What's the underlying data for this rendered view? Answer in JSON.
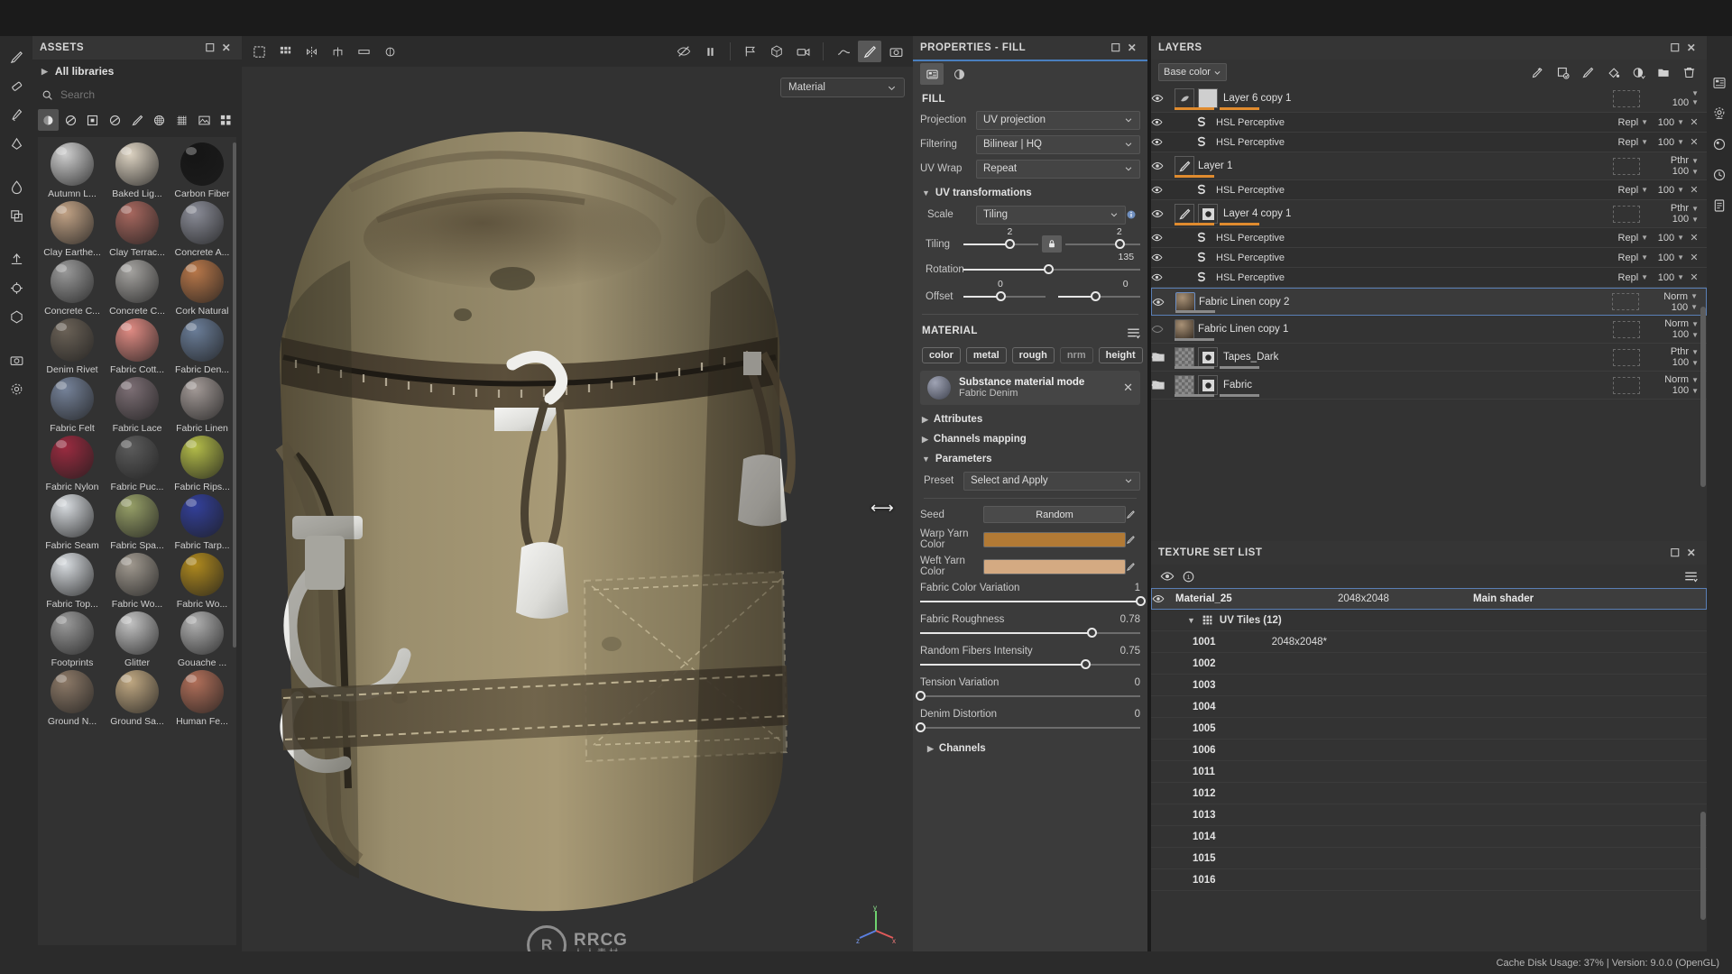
{
  "app": {
    "status_text": "Cache Disk Usage:   37% | Version: 9.0.0 (OpenGL)"
  },
  "left_toolbar": {
    "tools": [
      {
        "name": "paint-tool-icon",
        "glyph": "brush"
      },
      {
        "name": "eraser-tool-icon",
        "glyph": "eraser"
      },
      {
        "name": "projection-tool-icon",
        "glyph": "proj"
      },
      {
        "name": "polygon-fill-tool-icon",
        "glyph": "polyfill"
      },
      {
        "name": "smudge-tool-icon",
        "glyph": "smudge"
      },
      {
        "name": "clone-tool-icon",
        "glyph": "clone"
      },
      {
        "name": "export-icon",
        "glyph": "export"
      },
      {
        "name": "bake-icon",
        "glyph": "bake"
      },
      {
        "name": "tri-planar-icon",
        "glyph": "tri"
      },
      {
        "name": "camera-icon",
        "glyph": "cam"
      },
      {
        "name": "settings-icon",
        "glyph": "gear"
      }
    ]
  },
  "assets": {
    "title": "ASSETS",
    "library_label": "All libraries",
    "search_placeholder": "Search",
    "filters": [
      {
        "name": "filter-materials-icon",
        "active": true
      },
      {
        "name": "filter-smart-materials-icon",
        "active": false
      },
      {
        "name": "filter-smart-masks-icon",
        "active": false
      },
      {
        "name": "filter-alphas-icon",
        "active": false
      },
      {
        "name": "filter-brushes-icon",
        "active": false
      },
      {
        "name": "filter-procedurals-icon",
        "active": false
      },
      {
        "name": "filter-grunges-icon",
        "active": false
      },
      {
        "name": "filter-textures-icon",
        "active": false
      },
      {
        "name": "filter-all-icon",
        "active": false
      }
    ],
    "items": [
      {
        "label": "Autumn L...",
        "color": "#cfcfcf"
      },
      {
        "label": "Baked Lig...",
        "color": "#ddd3c2"
      },
      {
        "label": "Carbon Fiber",
        "color": "#151515"
      },
      {
        "label": "Clay Earthe...",
        "color": "#c2a386"
      },
      {
        "label": "Clay Terrac...",
        "color": "#a8685f"
      },
      {
        "label": "Concrete A...",
        "color": "#8b8d98"
      },
      {
        "label": "Concrete C...",
        "color": "#9a9a9a"
      },
      {
        "label": "Concrete C...",
        "color": "#a5a3a0"
      },
      {
        "label": "Cork Natural",
        "color": "#b9784a"
      },
      {
        "label": "Denim Rivet",
        "color": "#6b6257"
      },
      {
        "label": "Fabric Cott...",
        "color": "#e08b83"
      },
      {
        "label": "Fabric Den...",
        "color": "#6b7e99"
      },
      {
        "label": "Fabric Felt",
        "color": "#76839a"
      },
      {
        "label": "Fabric Lace",
        "color": "#7d6f75"
      },
      {
        "label": "Fabric Linen",
        "color": "#a39a97"
      },
      {
        "label": "Fabric Nylon",
        "color": "#9b2b40"
      },
      {
        "label": "Fabric Puc...",
        "color": "#5c5c5c"
      },
      {
        "label": "Fabric Rips...",
        "color": "#b4bd49"
      },
      {
        "label": "Fabric Seam",
        "color": "#d8dce0"
      },
      {
        "label": "Fabric Spa...",
        "color": "#97a068"
      },
      {
        "label": "Fabric Tarp...",
        "color": "#33409b"
      },
      {
        "label": "Fabric Top...",
        "color": "#d8dce0"
      },
      {
        "label": "Fabric Wo...",
        "color": "#a19a90"
      },
      {
        "label": "Fabric Wo...",
        "color": "#b08a1e"
      },
      {
        "label": "Footprints",
        "color": "#9a9a9a"
      },
      {
        "label": "Glitter",
        "color": "#c3c3c3"
      },
      {
        "label": "Gouache ...",
        "color": "#b0b0b0"
      },
      {
        "label": "Ground N...",
        "color": "#8d7a68"
      },
      {
        "label": "Ground Sa...",
        "color": "#c0a882"
      },
      {
        "label": "Human Fe...",
        "color": "#b2705a"
      }
    ]
  },
  "viewport": {
    "toolbar": [
      {
        "name": "uv-view-toggle-icon",
        "active": false
      },
      {
        "name": "grid-toggle-icon",
        "active": false
      },
      {
        "name": "symmetry-icon",
        "active": false
      },
      {
        "name": "mirror-icon",
        "active": false
      },
      {
        "name": "display-settings-icon",
        "active": false
      },
      {
        "name": "rotate-env-icon",
        "active": false
      },
      {
        "name": "hide-overlay-icon",
        "active": false
      },
      {
        "name": "pause-engine-icon",
        "active": false
      },
      {
        "name": "flag-icon",
        "active": false
      },
      {
        "name": "3d-view-icon",
        "active": false
      },
      {
        "name": "camera-view-icon",
        "active": false
      },
      {
        "name": "physical-size-icon",
        "active": false
      },
      {
        "name": "paint-mode-icon",
        "active": true
      },
      {
        "name": "screenshot-icon",
        "active": false
      }
    ],
    "material_select": "Material"
  },
  "properties": {
    "title": "PROPERTIES - FILL",
    "fill": {
      "heading": "FILL",
      "projection_label": "Projection",
      "projection_value": "UV projection",
      "filtering_label": "Filtering",
      "filtering_value": "Bilinear | HQ",
      "uvwrap_label": "UV Wrap",
      "uvwrap_value": "Repeat"
    },
    "uv_transformations": {
      "heading": "UV transformations",
      "scale_label": "Scale",
      "scale_value": "Tiling",
      "tiling_label": "Tiling",
      "tiling_u": "2",
      "tiling_v": "2",
      "rotation_label": "Rotation",
      "rotation_value": "135",
      "offset_label": "Offset",
      "offset_u": "0",
      "offset_v": "0"
    },
    "material": {
      "heading": "MATERIAL",
      "channels": [
        {
          "label": "color",
          "on": true
        },
        {
          "label": "metal",
          "on": true
        },
        {
          "label": "rough",
          "on": true
        },
        {
          "label": "nrm",
          "on": false
        },
        {
          "label": "height",
          "on": true
        }
      ],
      "card_title": "Substance material mode",
      "card_subtitle": "Fabric Denim"
    },
    "groups": {
      "attributes": "Attributes",
      "channels_mapping": "Channels mapping",
      "parameters": "Parameters",
      "channels": "Channels"
    },
    "parameters": {
      "preset_label": "Preset",
      "preset_value": "Select and Apply",
      "seed_label": "Seed",
      "seed_value": "Random",
      "warp_label": "Warp Yarn Color",
      "warp_color": "#b27a35",
      "weft_label": "Weft Yarn Color",
      "weft_color": "#d4aa82",
      "sliders": [
        {
          "label": "Fabric Color Variation",
          "value": "1",
          "pct": 100
        },
        {
          "label": "Fabric Roughness",
          "value": "0.78",
          "pct": 78
        },
        {
          "label": "Random Fibers Intensity",
          "value": "0.75",
          "pct": 75
        },
        {
          "label": "Tension Variation",
          "value": "0",
          "pct": 0
        },
        {
          "label": "Denim Distortion",
          "value": "0",
          "pct": 0
        }
      ]
    }
  },
  "layers": {
    "title": "LAYERS",
    "channel_select": "Base color",
    "toolbar": [
      {
        "name": "add-effect-icon"
      },
      {
        "name": "add-fill-layer-icon"
      },
      {
        "name": "add-paint-layer-icon"
      },
      {
        "name": "add-fill-icon"
      },
      {
        "name": "add-adjustment-icon"
      },
      {
        "name": "add-folder-icon"
      },
      {
        "name": "delete-layer-icon"
      }
    ],
    "rows": [
      {
        "kind": "layer",
        "visible": true,
        "name": "Layer 6 copy 1",
        "blend": "",
        "opacity": "100",
        "thumb": "smudge",
        "mask": "masked",
        "bars": [
          "#e08b2e",
          "#e08b2e"
        ],
        "partial": true
      },
      {
        "kind": "effect",
        "visible": true,
        "name": "HSL Perceptive",
        "blend": "Repl",
        "opacity": "100"
      },
      {
        "kind": "effect",
        "visible": true,
        "name": "HSL Perceptive",
        "blend": "Repl",
        "opacity": "100"
      },
      {
        "kind": "layer",
        "visible": true,
        "name": "Layer 1",
        "blend": "Pthr",
        "opacity": "100",
        "thumb": "brush",
        "mask": "none",
        "bars": [
          "#e08b2e"
        ]
      },
      {
        "kind": "effect",
        "visible": true,
        "name": "HSL Perceptive",
        "blend": "Repl",
        "opacity": "100"
      },
      {
        "kind": "layer",
        "visible": true,
        "name": "Layer 4 copy 1",
        "blend": "Pthr",
        "opacity": "100",
        "thumb": "brush",
        "mask": "circle",
        "bars": [
          "#e08b2e",
          "#e08b2e"
        ]
      },
      {
        "kind": "effect",
        "visible": true,
        "name": "HSL Perceptive",
        "blend": "Repl",
        "opacity": "100"
      },
      {
        "kind": "effect",
        "visible": true,
        "name": "HSL Perceptive",
        "blend": "Repl",
        "opacity": "100"
      },
      {
        "kind": "effect",
        "visible": true,
        "name": "HSL Perceptive",
        "blend": "Repl",
        "opacity": "100"
      },
      {
        "kind": "layer",
        "visible": true,
        "selected": true,
        "name": "Fabric Linen copy 2",
        "blend": "Norm",
        "opacity": "100",
        "thumb": "ball",
        "mask": "none",
        "bars": [
          "#8a8a8a"
        ]
      },
      {
        "kind": "layer",
        "visible": false,
        "name": "Fabric Linen copy 1",
        "blend": "Norm",
        "opacity": "100",
        "thumb": "ball",
        "mask": "none",
        "bars": [
          "#8a8a8a"
        ]
      },
      {
        "kind": "folder",
        "visible": true,
        "name": "Tapes_Dark",
        "blend": "Pthr",
        "opacity": "100",
        "bars": [
          "#8a8a8a",
          "#8a8a8a"
        ]
      },
      {
        "kind": "folder",
        "visible": true,
        "name": "Fabric",
        "blend": "Norm",
        "opacity": "100",
        "bars": [
          "#8a8a8a",
          "#8a8a8a"
        ]
      }
    ]
  },
  "texture_set_list": {
    "title": "TEXTURE SET LIST",
    "material": {
      "name": "Material_25",
      "resolution": "2048x2048",
      "shader": "Main shader"
    },
    "uv_tiles_label": "UV Tiles (12)",
    "tiles": [
      {
        "id": "1001",
        "res": "2048x2048*"
      },
      {
        "id": "1002",
        "res": ""
      },
      {
        "id": "1003",
        "res": ""
      },
      {
        "id": "1004",
        "res": ""
      },
      {
        "id": "1005",
        "res": ""
      },
      {
        "id": "1006",
        "res": ""
      },
      {
        "id": "1011",
        "res": ""
      },
      {
        "id": "1012",
        "res": ""
      },
      {
        "id": "1013",
        "res": ""
      },
      {
        "id": "1014",
        "res": ""
      },
      {
        "id": "1015",
        "res": ""
      },
      {
        "id": "1016",
        "res": ""
      }
    ]
  },
  "watermark": {
    "line1": "RRCG",
    "line2": "人人素材",
    "ring": "R"
  },
  "right_rail": [
    {
      "name": "properties-rail-icon"
    },
    {
      "name": "display-settings-rail-icon"
    },
    {
      "name": "shader-settings-rail-icon"
    },
    {
      "name": "history-rail-icon"
    },
    {
      "name": "log-rail-icon"
    }
  ]
}
